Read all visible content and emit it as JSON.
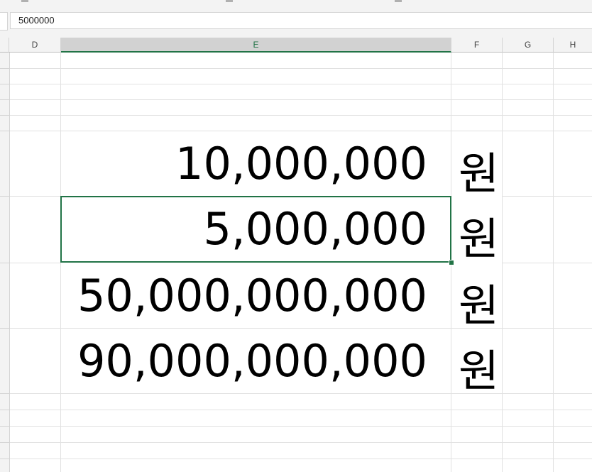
{
  "formula_bar": {
    "value": "5000000"
  },
  "columns": {
    "d": "D",
    "e": "E",
    "f": "F",
    "g": "G",
    "h": "H"
  },
  "cells": [
    {
      "value": "10,000,000",
      "unit": "원"
    },
    {
      "value": "5,000,000",
      "unit": "원"
    },
    {
      "value": "50,000,000,000",
      "unit": "원"
    },
    {
      "value": "90,000,000,000",
      "unit": "원"
    }
  ],
  "colors": {
    "selection": "#217346",
    "gridline": "#e1e1e1",
    "header_bg": "#f3f3f3"
  }
}
